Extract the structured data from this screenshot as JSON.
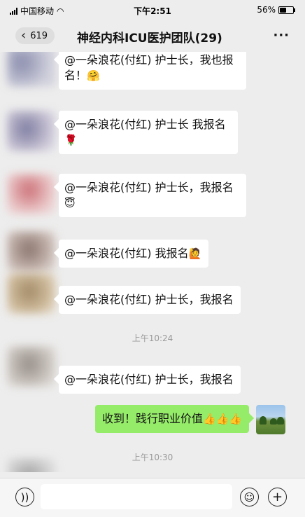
{
  "status": {
    "carrier": "中国移动",
    "time": "下午2:51",
    "battery_percent": "56%",
    "battery_level": 0.56
  },
  "nav": {
    "back_count": "619",
    "title": "神经内科ICU医护团队(29)",
    "more_label": "···"
  },
  "messages": [
    {
      "text_line1": "@一朵浪花(付红) 护士长，我也报",
      "text_line2": "名！",
      "emoji": "🤗"
    },
    {
      "text_line1": "@一朵浪花(付红) 护士长 我报名",
      "emoji": "🌹"
    },
    {
      "text_line1": "@一朵浪花(付红) 护士长，我报名",
      "emoji": "😇"
    },
    {
      "text": "@一朵浪花(付红) 我报名",
      "emoji": "🙋"
    },
    {
      "text": "@一朵浪花(付红) 护士长，我报名"
    },
    {
      "text": "@一朵浪花(付红) 护士长，我报名"
    }
  ],
  "time_separators": [
    "上午10:24",
    "上午10:30"
  ],
  "my_message": {
    "text": "收到！践行职业价值",
    "emoji": "👍👍👍"
  },
  "colors": {
    "background": "#ededed",
    "incoming_bubble": "#ffffff",
    "outgoing_bubble": "#95ec69"
  },
  "icons": {
    "voice": "voice-icon",
    "emoji": "emoji-icon",
    "plus": "plus-icon"
  }
}
